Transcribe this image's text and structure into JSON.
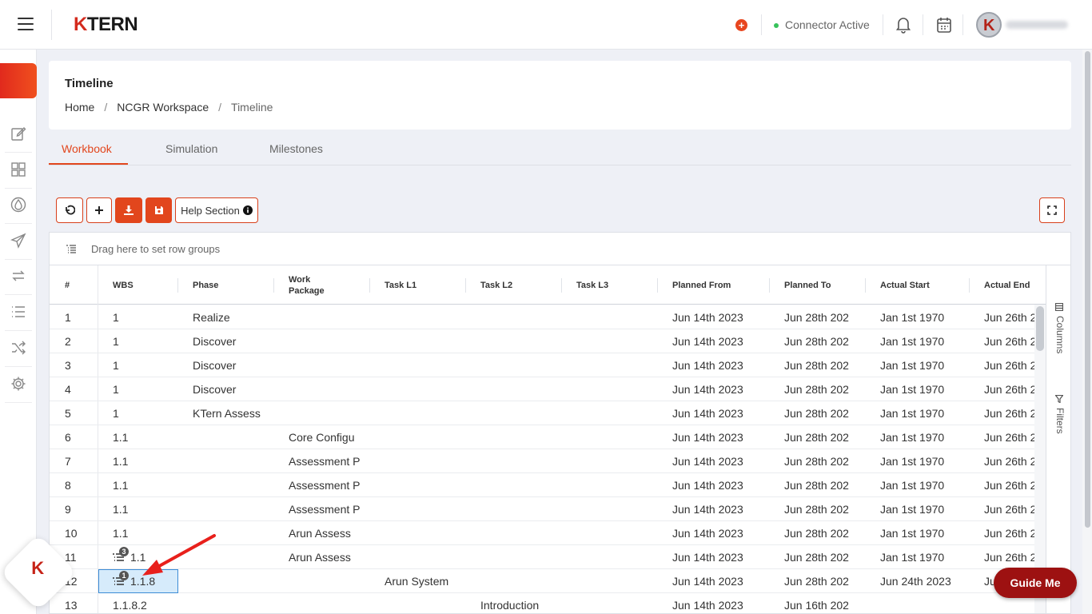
{
  "header": {
    "logo_k": "K",
    "logo_rest": "TERN",
    "connector_status": "Connector Active"
  },
  "page": {
    "title": "Timeline",
    "breadcrumb": [
      "Home",
      "NCGR Workspace",
      "Timeline"
    ]
  },
  "tabs": [
    "Workbook",
    "Simulation",
    "Milestones"
  ],
  "toolbar": {
    "help_label": "Help Section"
  },
  "grid": {
    "group_placeholder": "Drag here to set row groups",
    "columns": [
      "#",
      "WBS",
      "Phase",
      "Work Package",
      "Task L1",
      "Task L2",
      "Task L3",
      "Planned From",
      "Planned To",
      "Actual Start",
      "Actual End"
    ],
    "side_tabs": [
      "Columns",
      "Filters"
    ],
    "rows": [
      {
        "n": "1",
        "wbs": "1",
        "phase": "Realize",
        "wp": "",
        "l1": "",
        "l2": "",
        "pf": "Jun 14th 2023",
        "pt": "Jun 28th 202",
        "as": "Jan 1st 1970",
        "ae": "Jun 26th 2"
      },
      {
        "n": "2",
        "wbs": "1",
        "phase": "Discover",
        "wp": "",
        "l1": "",
        "l2": "",
        "pf": "Jun 14th 2023",
        "pt": "Jun 28th 202",
        "as": "Jan 1st 1970",
        "ae": "Jun 26th 2"
      },
      {
        "n": "3",
        "wbs": "1",
        "phase": "Discover",
        "wp": "",
        "l1": "",
        "l2": "",
        "pf": "Jun 14th 2023",
        "pt": "Jun 28th 202",
        "as": "Jan 1st 1970",
        "ae": "Jun 26th 2"
      },
      {
        "n": "4",
        "wbs": "1",
        "phase": "Discover",
        "wp": "",
        "l1": "",
        "l2": "",
        "pf": "Jun 14th 2023",
        "pt": "Jun 28th 202",
        "as": "Jan 1st 1970",
        "ae": "Jun 26th 2"
      },
      {
        "n": "5",
        "wbs": "1",
        "phase": "KTern Assess",
        "wp": "",
        "l1": "",
        "l2": "",
        "pf": "Jun 14th 2023",
        "pt": "Jun 28th 202",
        "as": "Jan 1st 1970",
        "ae": "Jun 26th 2"
      },
      {
        "n": "6",
        "wbs": "1.1",
        "phase": "",
        "wp": "Core Configu",
        "l1": "",
        "l2": "",
        "pf": "Jun 14th 2023",
        "pt": "Jun 28th 202",
        "as": "Jan 1st 1970",
        "ae": "Jun 26th 2"
      },
      {
        "n": "7",
        "wbs": "1.1",
        "phase": "",
        "wp": "Assessment P",
        "l1": "",
        "l2": "",
        "pf": "Jun 14th 2023",
        "pt": "Jun 28th 202",
        "as": "Jan 1st 1970",
        "ae": "Jun 26th 2"
      },
      {
        "n": "8",
        "wbs": "1.1",
        "phase": "",
        "wp": "Assessment P",
        "l1": "",
        "l2": "",
        "pf": "Jun 14th 2023",
        "pt": "Jun 28th 202",
        "as": "Jan 1st 1970",
        "ae": "Jun 26th 2"
      },
      {
        "n": "9",
        "wbs": "1.1",
        "phase": "",
        "wp": "Assessment P",
        "l1": "",
        "l2": "",
        "pf": "Jun 14th 2023",
        "pt": "Jun 28th 202",
        "as": "Jan 1st 1970",
        "ae": "Jun 26th 2"
      },
      {
        "n": "10",
        "wbs": "1.1",
        "phase": "",
        "wp": "Arun Assess",
        "l1": "",
        "l2": "",
        "pf": "Jun 14th 2023",
        "pt": "Jun 28th 202",
        "as": "Jan 1st 1970",
        "ae": "Jun 26th 2"
      },
      {
        "n": "11",
        "wbs": "1.1",
        "phase": "",
        "wp": "Arun Assess",
        "l1": "",
        "l2": "",
        "pf": "Jun 14th 2023",
        "pt": "Jun 28th 202",
        "as": "Jan 1st 1970",
        "ae": "Jun 26th 2",
        "badge": "3"
      },
      {
        "n": "12",
        "wbs": "1.1.8",
        "phase": "",
        "wp": "",
        "l1": "Arun System",
        "l2": "",
        "pf": "Jun 14th 2023",
        "pt": "Jun 28th 202",
        "as": "Jun 24th 2023",
        "ae": "Ju",
        "badge": "1",
        "selected": true
      },
      {
        "n": "13",
        "wbs": "1.1.8.2",
        "phase": "",
        "wp": "",
        "l1": "",
        "l2": "Introduction",
        "pf": "Jun 14th 2023",
        "pt": "Jun 16th 202",
        "as": "",
        "ae": ""
      }
    ]
  },
  "guide_button": "Guide Me",
  "colors": {
    "accent": "#e2461d",
    "brand_red": "#d42b1e",
    "guide_button": "#9d1111",
    "status_green": "#37c25b"
  },
  "icons": [
    "hamburger-icon",
    "add-circle-icon",
    "bell-icon",
    "calendar-icon",
    "edit-icon",
    "dashboard-icon",
    "drop-icon",
    "send-icon",
    "sync-icon",
    "list-icon",
    "shuffle-icon",
    "gear-icon",
    "undo-icon",
    "plus-icon",
    "download-icon",
    "save-icon",
    "info-icon",
    "expand-icon",
    "columns-icon",
    "filter-icon",
    "tree-icon"
  ]
}
